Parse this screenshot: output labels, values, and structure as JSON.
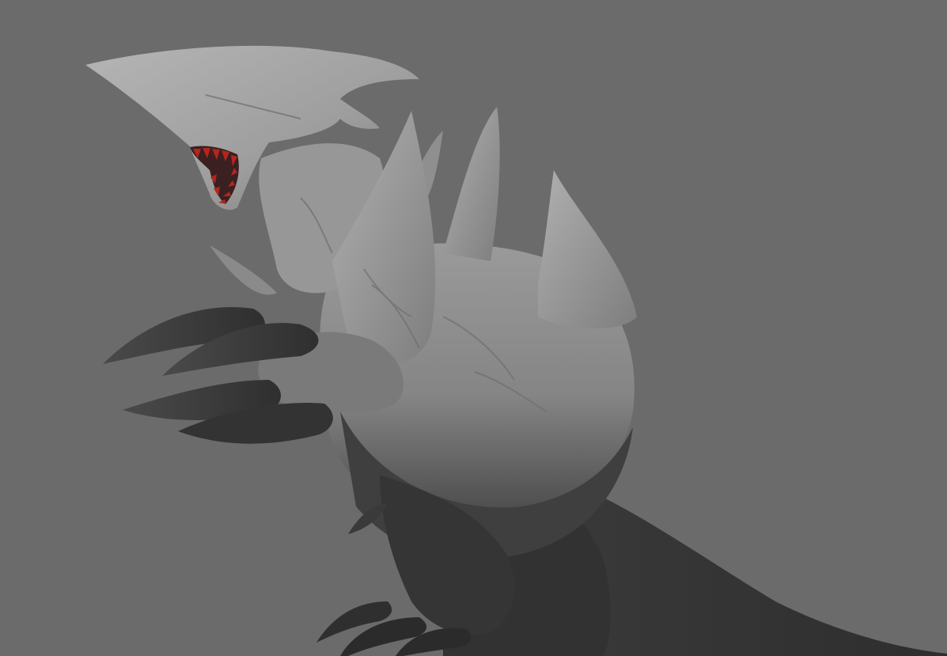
{
  "viewport": {
    "background_color": "#6b6b6b"
  },
  "model": {
    "subject_icon": "shark-headed-monster-sculpt",
    "surface_color_light": "#a9a9a9",
    "surface_color_mid": "#7c7c7c",
    "surface_color_dark": "#3c3c3c",
    "surface_color_shadow": "#2b2b2b",
    "teeth_color": "#b3261e"
  }
}
